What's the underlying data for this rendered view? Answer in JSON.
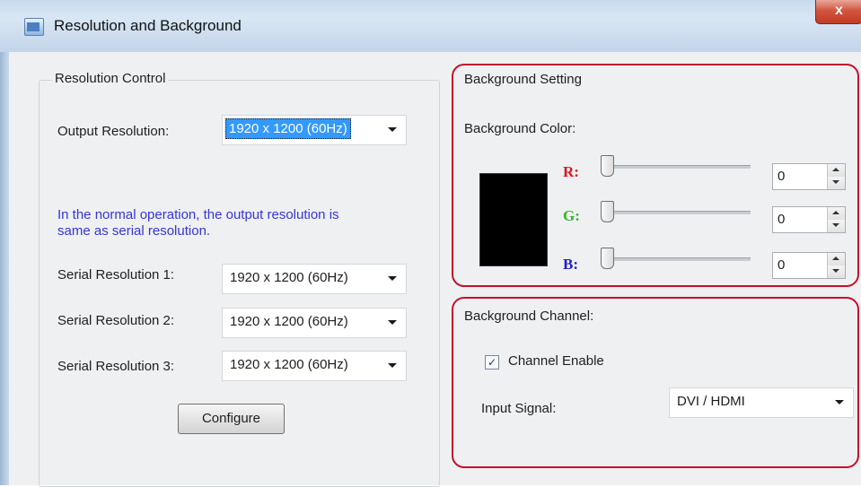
{
  "window": {
    "title": "Resolution and Background",
    "close_label": "x"
  },
  "resolution_control": {
    "title": "Resolution Control",
    "output_label": "Output Resolution:",
    "output_value": "1920 x 1200 (60Hz)",
    "info_line1": "In the normal operation, the output resolution is",
    "info_line2": "same as serial resolution.",
    "serial": [
      {
        "label": "Serial Resolution 1:",
        "value": "1920 x 1200 (60Hz)"
      },
      {
        "label": "Serial Resolution 2:",
        "value": "1920 x 1200 (60Hz)"
      },
      {
        "label": "Serial Resolution 3:",
        "value": "1920 x 1200 (60Hz)"
      }
    ],
    "configure_label": "Configure"
  },
  "background_setting": {
    "title": "Background Setting",
    "color_label": "Background Color:",
    "swatch_color": "#000000",
    "channels": [
      {
        "label": "R:",
        "value": "0",
        "color": "#e0141e",
        "level": 0
      },
      {
        "label": "G:",
        "value": "0",
        "color": "#2fb52f",
        "level": 0
      },
      {
        "label": "B:",
        "value": "0",
        "color": "#1c1cd8",
        "level": 0
      }
    ]
  },
  "background_channel": {
    "title": "Background Channel:",
    "enable_label": "Channel Enable",
    "enable_checked": true,
    "input_label": "Input Signal:",
    "input_value": "DVI / HDMI"
  },
  "icons": {
    "window": "window-app-icon",
    "dropdown": "chevron-down-icon",
    "check": "checkmark-icon"
  },
  "colors": {
    "callout": "#c4102a",
    "info_text": "#3636d8",
    "selection": "#3399ff"
  }
}
